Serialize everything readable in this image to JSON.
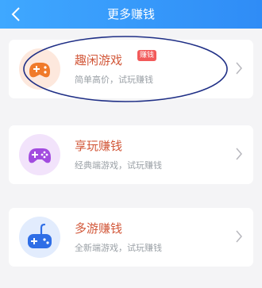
{
  "header": {
    "title": "更多赚钱"
  },
  "cards": [
    {
      "title": "趣闲游戏",
      "subtitle": "简单高价，试玩赚钱",
      "badge": "赚钱"
    },
    {
      "title": "享玩赚钱",
      "subtitle": "经典端游戏，试玩赚钱"
    },
    {
      "title": "多游赚钱",
      "subtitle": "全新端游戏，试玩赚钱"
    }
  ],
  "colors": {
    "header": "#2f8cf6",
    "title_text": "#d2583a",
    "badge": "#f25a5a",
    "icon_orange": "#f07a2a",
    "icon_purple": "#a24bdf",
    "icon_blue": "#2f6ee6",
    "annotation": "#1f2f86"
  }
}
